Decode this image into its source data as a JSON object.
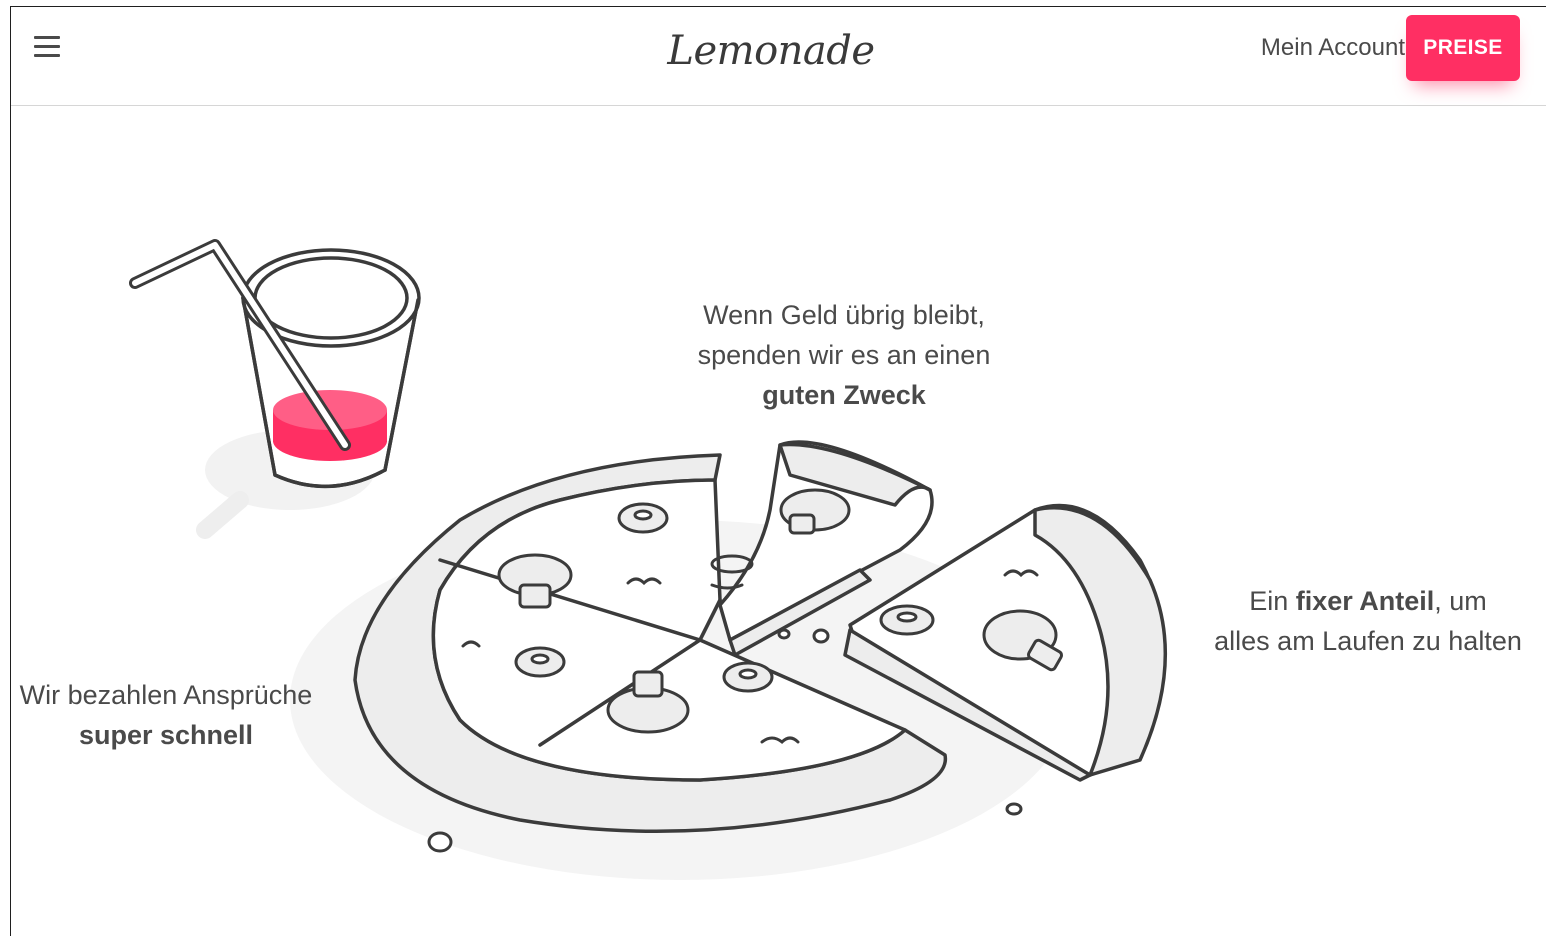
{
  "header": {
    "logo_text": "Lemonade",
    "account_label": "Mein Account",
    "price_button_label": "PREISE"
  },
  "illustration": {
    "captions": {
      "top": {
        "line1": "Wenn Geld übrig bleibt,",
        "line2": "spenden wir es an einen",
        "bold": "guten Zweck"
      },
      "right": {
        "prefix": "Ein ",
        "bold": "fixer Anteil",
        "suffix": ", um",
        "line2": "alles am Laufen zu halten"
      },
      "left": {
        "line1": "Wir bezahlen Ansprüche",
        "bold": "super schnell"
      }
    }
  },
  "colors": {
    "accent": "#ff2f63",
    "text": "#4a4a4a",
    "outline": "#3b3b3b",
    "fill": "#ededed"
  }
}
